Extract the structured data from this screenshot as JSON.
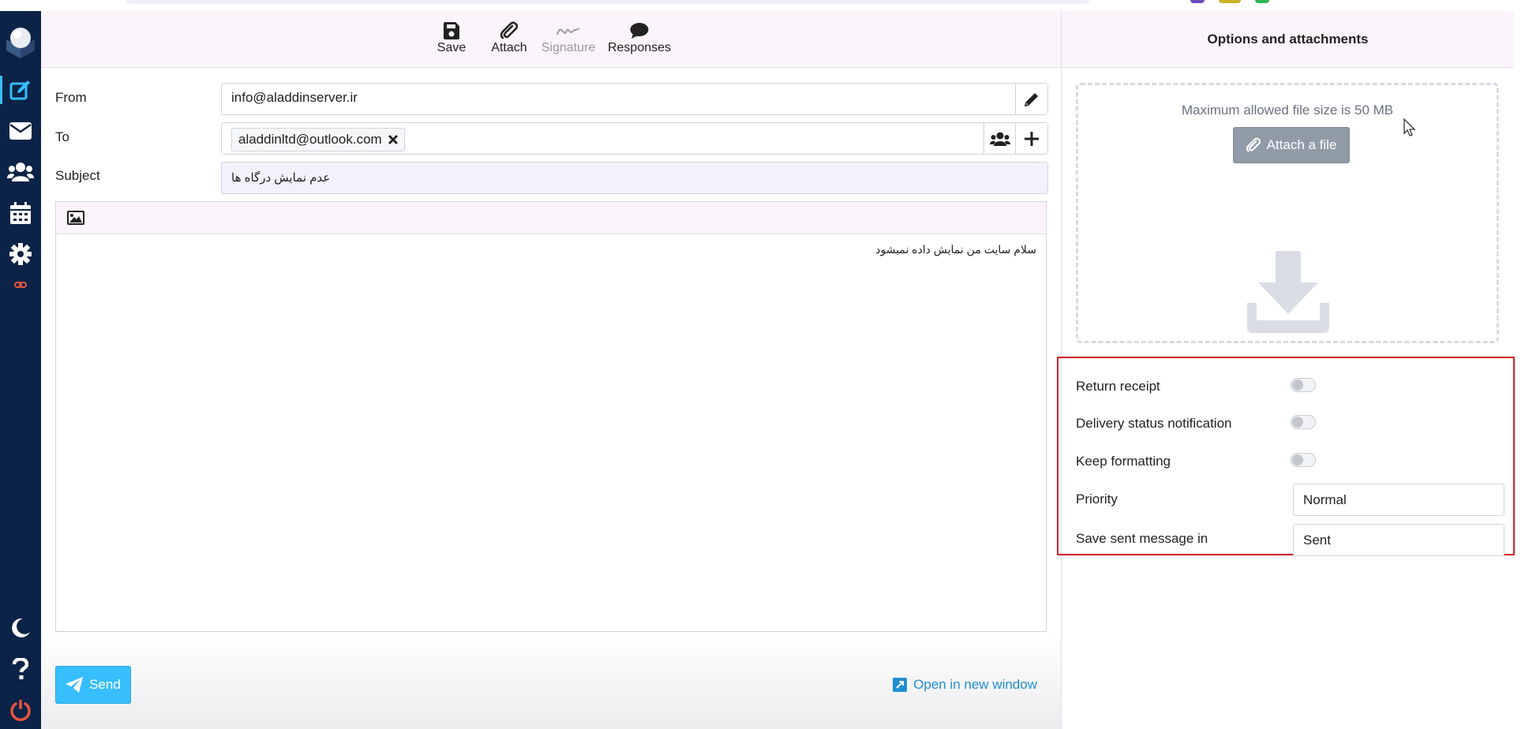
{
  "toolbar": {
    "save": "Save",
    "attach": "Attach",
    "signature": "Signature",
    "responses": "Responses"
  },
  "form": {
    "from_label": "From",
    "from_value": "info@aladdinserver.ir",
    "to_label": "To",
    "to_recipient": "aladdinltd@outlook.com",
    "subject_label": "Subject",
    "subject_value": "عدم نمایش درگاه ها"
  },
  "editor": {
    "body": "سلام سایت من نمایش داده نمیشود"
  },
  "footer": {
    "send": "Send",
    "open_new_window": "Open in new window"
  },
  "options": {
    "title": "Options and attachments",
    "max_size_hint": "Maximum allowed file size is 50 MB",
    "attach_file": "Attach a file",
    "return_receipt": "Return receipt",
    "dsn": "Delivery status notification",
    "keep_formatting": "Keep formatting",
    "priority_label": "Priority",
    "priority_value": "Normal",
    "save_sent_label": "Save sent message in",
    "save_sent_value": "Sent",
    "return_receipt_on": false,
    "dsn_on": false,
    "keep_formatting_on": false
  },
  "icons": {
    "nav": [
      "compose-icon",
      "mail-icon",
      "contacts-icon",
      "calendar-icon",
      "settings-icon",
      "link-icon"
    ],
    "nav_bottom": [
      "moon-icon",
      "help-icon",
      "power-icon"
    ]
  },
  "colors": {
    "nav_bg": "#0b2346",
    "accent": "#37beff",
    "highlight_border": "#d51f2a",
    "toolbar_bg": "#fbf4fb"
  }
}
